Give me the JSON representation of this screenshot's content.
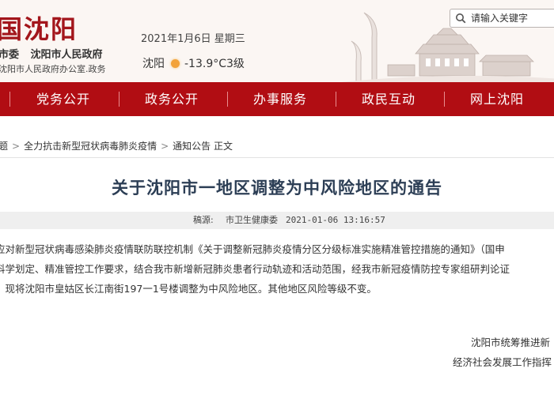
{
  "header": {
    "site_title": "国沈阳",
    "sub_orgs": [
      "市委",
      "沈阳市人民政府"
    ],
    "office": "沈阳市人民政府办公室.政务",
    "date": "2021年1月6日 星期三",
    "weather": {
      "city": "沈阳",
      "condition_icon": "sun-icon",
      "temp": "-13.9°C3级"
    },
    "search_placeholder": "请输入关键字"
  },
  "nav": {
    "items": [
      {
        "label": "党务公开"
      },
      {
        "label": "政务公开"
      },
      {
        "label": "办事服务"
      },
      {
        "label": "政民互动"
      },
      {
        "label": "网上沈阳"
      }
    ],
    "bg_color": "#b10d13"
  },
  "breadcrumb": [
    "题",
    "全力抗击新型冠状病毒肺炎疫情",
    "通知公告",
    "正文"
  ],
  "article": {
    "title": "关于沈阳市一地区调整为中风险地区的通告",
    "source_label": "稿源:",
    "source": "市卫生健康委",
    "time": "2021-01-06 13:16:57",
    "paragraphs": [
      "应对新型冠状病毒感染肺炎疫情联防联控机制《关于调整新冠肺炎疫情分区分级标准实施精准管控措施的通知》（国申",
      "科学划定、精准管控工作要求，结合我市新增新冠肺炎患者行动轨迹和活动范围，经我市新冠疫情防控专家组研判论证",
      "，现将沈阳市皇姑区长江南街197一1号楼调整为中风险地区。其他地区风险等级不变。"
    ],
    "signature": [
      "沈阳市统筹推进新",
      "经济社会发展工作指挥"
    ]
  }
}
